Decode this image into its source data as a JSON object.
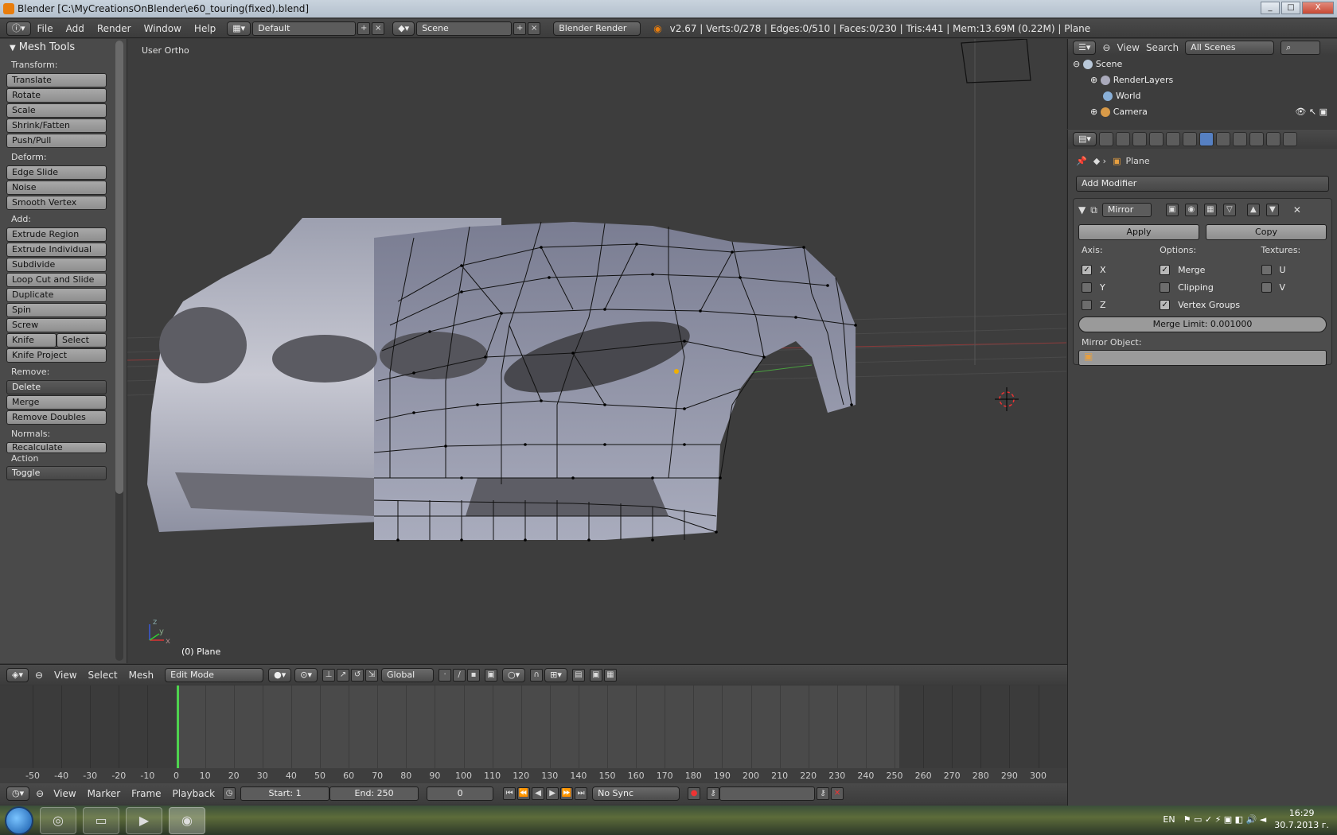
{
  "window": {
    "title": "Blender [C:\\MyCreationsOnBlender\\e60_touring(fixed).blend]",
    "min": "_",
    "max": "□",
    "close": "X"
  },
  "topbar": {
    "menus": [
      "File",
      "Add",
      "Render",
      "Window",
      "Help"
    ],
    "layout": "Default",
    "scene": "Scene",
    "engine": "Blender Render",
    "stats": "v2.67 | Verts:0/278 | Edges:0/510 | Faces:0/230 | Tris:441 | Mem:13.69M (0.22M) | Plane"
  },
  "toolshelf": {
    "title": "Mesh Tools",
    "sections": {
      "transform": "Transform:",
      "deform": "Deform:",
      "add": "Add:",
      "remove": "Remove:",
      "normals": "Normals:",
      "action": "Action"
    },
    "transform": [
      "Translate",
      "Rotate",
      "Scale",
      "Shrink/Fatten",
      "Push/Pull"
    ],
    "deform": [
      "Edge Slide",
      "Noise",
      "Smooth Vertex"
    ],
    "add": [
      "Extrude Region",
      "Extrude Individual",
      "Subdivide",
      "Loop Cut and Slide",
      "Duplicate",
      "Spin",
      "Screw"
    ],
    "knife": "Knife",
    "select": "Select",
    "knife_project": "Knife Project",
    "remove": {
      "delete": "Delete",
      "merge": "Merge",
      "remove_doubles": "Remove Doubles"
    },
    "recalculate": "Recalculate",
    "toggle": "Toggle"
  },
  "viewport": {
    "label": "User Ortho",
    "object": "(0) Plane",
    "axes": {
      "x": "x",
      "y": "y",
      "z": "z"
    }
  },
  "bar3d": {
    "menus": [
      "View",
      "Select",
      "Mesh"
    ],
    "mode": "Edit Mode",
    "orientation": "Global"
  },
  "outliner": {
    "menus": [
      "View",
      "Search"
    ],
    "filter": "All Scenes",
    "rows": [
      "Scene",
      "RenderLayers",
      "World",
      "Camera"
    ]
  },
  "properties": {
    "context": "Plane",
    "add_modifier": "Add Modifier",
    "modifier": {
      "name": "Mirror",
      "apply": "Apply",
      "copy": "Copy",
      "axis_title": "Axis:",
      "options_title": "Options:",
      "textures_title": "Textures:",
      "axis": [
        {
          "label": "X",
          "checked": true
        },
        {
          "label": "Y",
          "checked": false
        },
        {
          "label": "Z",
          "checked": false
        }
      ],
      "options": [
        {
          "label": "Merge",
          "checked": true
        },
        {
          "label": "Clipping",
          "checked": false
        },
        {
          "label": "Vertex Groups",
          "checked": true
        }
      ],
      "textures": [
        {
          "label": "U",
          "checked": false
        },
        {
          "label": "V",
          "checked": false
        }
      ],
      "merge_limit": "Merge Limit: 0.001000",
      "mirror_object": "Mirror Object:"
    }
  },
  "timeline": {
    "ticks": [
      "-50",
      "-40",
      "-30",
      "-20",
      "-10",
      "0",
      "10",
      "20",
      "30",
      "40",
      "50",
      "60",
      "70",
      "80",
      "90",
      "100",
      "110",
      "120",
      "130",
      "140",
      "150",
      "160",
      "170",
      "180",
      "190",
      "200",
      "210",
      "220",
      "230",
      "240",
      "250",
      "260",
      "270",
      "280",
      "290",
      "300"
    ],
    "menus": [
      "View",
      "Marker",
      "Frame",
      "Playback"
    ],
    "start": "Start: 1",
    "end": "End: 250",
    "current": "0",
    "sync": "No Sync"
  },
  "taskbar": {
    "lang": "EN",
    "time": "16:29",
    "date": "30.7.2013 г."
  },
  "colors": {
    "bg": "#393939",
    "accent": "#5680c2",
    "frame": "#4fd34f"
  }
}
